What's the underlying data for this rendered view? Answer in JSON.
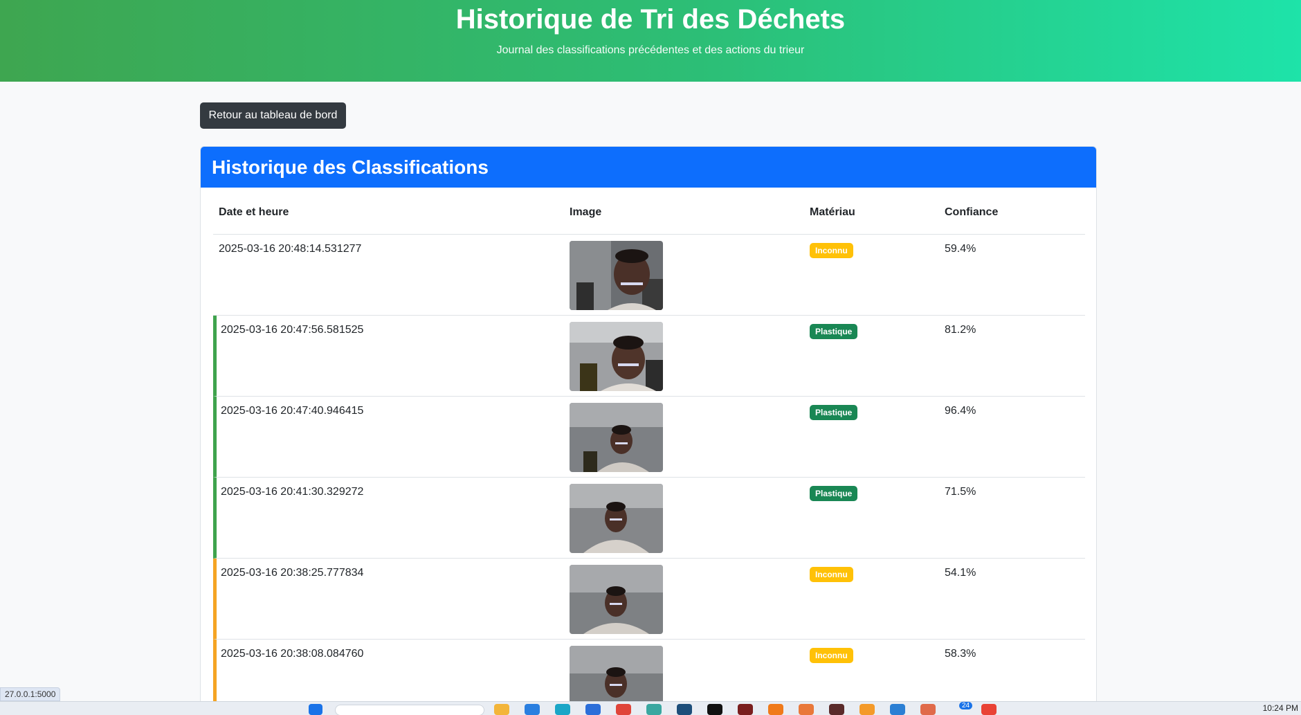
{
  "header": {
    "title": "Historique de Tri des Déchets",
    "subtitle": "Journal des classifications précédentes et des actions du trieur"
  },
  "back_button": {
    "label": "Retour au tableau de bord"
  },
  "card": {
    "title": "Historique des Classifications"
  },
  "table": {
    "columns": [
      "Date et heure",
      "Image",
      "Matériau",
      "Confiance"
    ],
    "rows": [
      {
        "datetime": "2025-03-16 20:48:14.531277",
        "material": "Inconnu",
        "confidence": "59.4%"
      },
      {
        "datetime": "2025-03-16 20:47:56.581525",
        "material": "Plastique",
        "confidence": "81.2%"
      },
      {
        "datetime": "2025-03-16 20:47:40.946415",
        "material": "Plastique",
        "confidence": "96.4%"
      },
      {
        "datetime": "2025-03-16 20:41:30.329272",
        "material": "Plastique",
        "confidence": "71.5%"
      },
      {
        "datetime": "2025-03-16 20:38:25.777834",
        "material": "Inconnu",
        "confidence": "54.1%"
      },
      {
        "datetime": "2025-03-16 20:38:08.084760",
        "material": "Inconnu",
        "confidence": "58.3%"
      }
    ]
  },
  "status_bar": {
    "url": "27.0.0.1:5000"
  },
  "taskbar": {
    "clock": "10:24 PM",
    "notification_count": "24"
  },
  "colors": {
    "header_gradient_start": "#3ea650",
    "header_gradient_end": "#1ee3a9",
    "card_header": "#0d6efd",
    "badge_unknown": "#ffc107",
    "badge_plastic": "#198754",
    "row_accent_green": "#3fa34d",
    "row_accent_orange": "#f5a423"
  }
}
